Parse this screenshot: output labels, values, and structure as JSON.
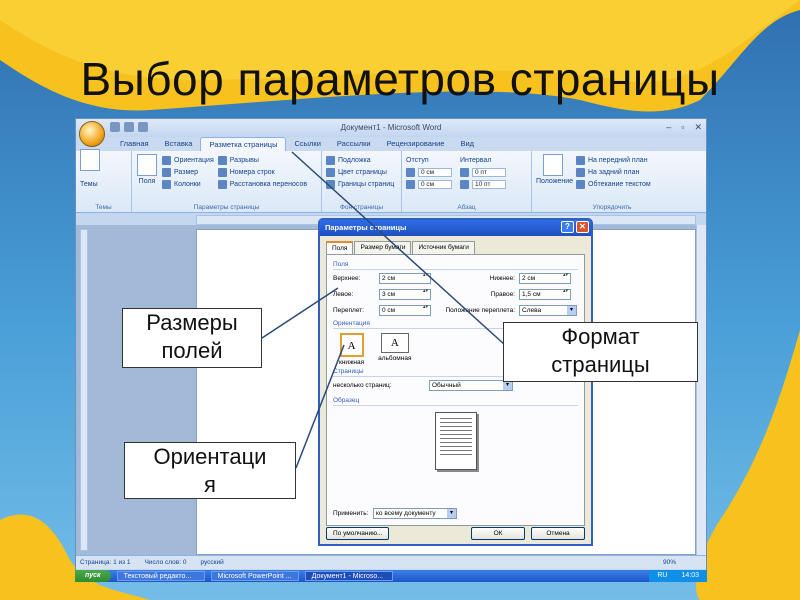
{
  "slide": {
    "title": "Выбор параметров страницы"
  },
  "word": {
    "title": "Документ1 - Microsoft Word",
    "controls": [
      "–",
      "▫",
      "✕"
    ],
    "tabs": [
      "Главная",
      "Вставка",
      "Разметка страницы",
      "Ссылки",
      "Рассылки",
      "Рецензирование",
      "Вид"
    ],
    "active_tab": "Разметка страницы",
    "ribbon": {
      "themes": {
        "label": "Темы",
        "btn": "Темы"
      },
      "page_setup": {
        "label": "Параметры страницы",
        "fields_btn": "Поля",
        "orientation": "Ориентация",
        "size": "Размер",
        "columns": "Колонки",
        "breaks": "Разрывы",
        "line_numbers": "Номера строк",
        "hyphenation": "Расстановка переносов"
      },
      "background": {
        "label": "Фон страницы",
        "watermark": "Подложка",
        "page_color": "Цвет страницы",
        "page_borders": "Границы страниц"
      },
      "paragraph": {
        "label": "Абзац",
        "indent": "Отступ",
        "spacing": "Интервал",
        "indent_left": "0 см",
        "indent_right": "0 см",
        "spacing_before": "0 пт",
        "spacing_after": "10 пт"
      },
      "arrange": {
        "label": "Упорядочить",
        "position": "Положение",
        "front": "На передний план",
        "back": "На задний план",
        "wrap": "Обтекание текстом"
      }
    },
    "status": {
      "page": "Страница: 1 из 1",
      "words": "Число слов: 0",
      "lang": "русский",
      "zoom": "90%"
    }
  },
  "dialog": {
    "title": "Параметры страницы",
    "tabs": [
      "Поля",
      "Размер бумаги",
      "Источник бумаги"
    ],
    "margins_section": "Поля",
    "top_label": "Верхнее:",
    "top_value": "2 см",
    "bottom_label": "Нижнее:",
    "bottom_value": "2 см",
    "left_label": "Левое:",
    "left_value": "3 см",
    "right_label": "Правое:",
    "right_value": "1,5 см",
    "gutter_label": "Переплет:",
    "gutter_value": "0 см",
    "gutter_pos_label": "Положение переплета:",
    "gutter_pos_value": "Слева",
    "orientation_section": "Ориентация",
    "portrait": "книжная",
    "landscape": "альбомная",
    "pages_section": "Страницы",
    "multiple_pages_label": "несколько страниц:",
    "multiple_pages_value": "Обычный",
    "preview_section": "Образец",
    "apply_label": "Применить:",
    "apply_value": "ко всему документу",
    "default_btn": "По умолчанию...",
    "ok_btn": "ОК",
    "cancel_btn": "Отмена"
  },
  "callouts": {
    "margins": [
      "Размеры",
      "полей"
    ],
    "format": [
      "Формат",
      "страницы"
    ],
    "orientation": [
      "Ориентаци",
      "я"
    ]
  },
  "taskbar": {
    "start": "пуск",
    "tasks": [
      "Текстовый редакто...",
      "Microsoft PowerPoint ...",
      "Документ1 - Microso..."
    ],
    "lang": "RU",
    "clock": "14:03"
  },
  "colors": {
    "slide_bg": "#3a86c8",
    "swoosh_yellow": "#f7c21d",
    "dialog_title": "#2e6ee6"
  }
}
